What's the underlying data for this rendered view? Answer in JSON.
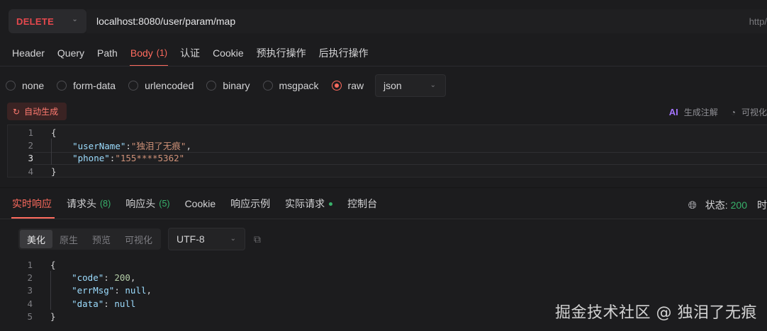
{
  "request": {
    "method": "DELETE",
    "url": "localhost:8080/user/param/map",
    "url_right": "http/"
  },
  "req_tabs": [
    {
      "label": "Header"
    },
    {
      "label": "Query"
    },
    {
      "label": "Path"
    },
    {
      "label": "Body",
      "count": "(1)",
      "active": true
    },
    {
      "label": "认证"
    },
    {
      "label": "Cookie"
    },
    {
      "label": "预执行操作"
    },
    {
      "label": "后执行操作"
    }
  ],
  "body_types": [
    "none",
    "form-data",
    "urlencoded",
    "binary",
    "msgpack",
    "raw"
  ],
  "body_type_selected": "raw",
  "format": "json",
  "auto_generate": "自动生成",
  "ai_tools": {
    "ai_label": "AI",
    "generate_comments": "生成注解",
    "visualize": "可视化"
  },
  "request_body_lines": [
    {
      "n": "1",
      "indent": "",
      "tokens": [
        {
          "t": "p",
          "v": "{"
        }
      ]
    },
    {
      "n": "2",
      "indent": "    ",
      "tokens": [
        {
          "t": "key",
          "v": "\"userName\""
        },
        {
          "t": "p",
          "v": ":"
        },
        {
          "t": "str",
          "v": "\"独泪了无痕\""
        },
        {
          "t": "p",
          "v": ","
        }
      ]
    },
    {
      "n": "3",
      "indent": "    ",
      "tokens": [
        {
          "t": "key",
          "v": "\"phone\""
        },
        {
          "t": "p",
          "v": ":"
        },
        {
          "t": "str",
          "v": "\"155****5362\""
        }
      ]
    },
    {
      "n": "4",
      "indent": "",
      "tokens": [
        {
          "t": "p",
          "v": "}"
        }
      ]
    }
  ],
  "current_line": "3",
  "resp_tabs": [
    {
      "label": "实时响应",
      "active": true
    },
    {
      "label": "请求头",
      "count": "(8)"
    },
    {
      "label": "响应头",
      "count": "(5)"
    },
    {
      "label": "Cookie"
    },
    {
      "label": "响应示例"
    },
    {
      "label": "实际请求",
      "dot": true
    },
    {
      "label": "控制台"
    }
  ],
  "status": {
    "label": "状态:",
    "code": "200",
    "trailing": "时"
  },
  "view_modes": [
    "美化",
    "原生",
    "预览",
    "可视化"
  ],
  "view_mode_selected": "美化",
  "encoding": "UTF-8",
  "response_body_lines": [
    {
      "n": "1",
      "indent": "",
      "tokens": [
        {
          "t": "p",
          "v": "{"
        }
      ]
    },
    {
      "n": "2",
      "indent": "    ",
      "tokens": [
        {
          "t": "key",
          "v": "\"code\""
        },
        {
          "t": "p",
          "v": ": "
        },
        {
          "t": "num",
          "v": "200"
        },
        {
          "t": "p",
          "v": ","
        }
      ]
    },
    {
      "n": "3",
      "indent": "    ",
      "tokens": [
        {
          "t": "key",
          "v": "\"errMsg\""
        },
        {
          "t": "p",
          "v": ": "
        },
        {
          "t": "nul",
          "v": "null"
        },
        {
          "t": "p",
          "v": ","
        }
      ]
    },
    {
      "n": "4",
      "indent": "    ",
      "tokens": [
        {
          "t": "key",
          "v": "\"data\""
        },
        {
          "t": "p",
          "v": ": "
        },
        {
          "t": "nul",
          "v": "null"
        }
      ]
    },
    {
      "n": "5",
      "indent": "",
      "tokens": [
        {
          "t": "p",
          "v": "}"
        }
      ]
    }
  ],
  "watermark": "掘金技术社区 @ 独泪了无痕"
}
